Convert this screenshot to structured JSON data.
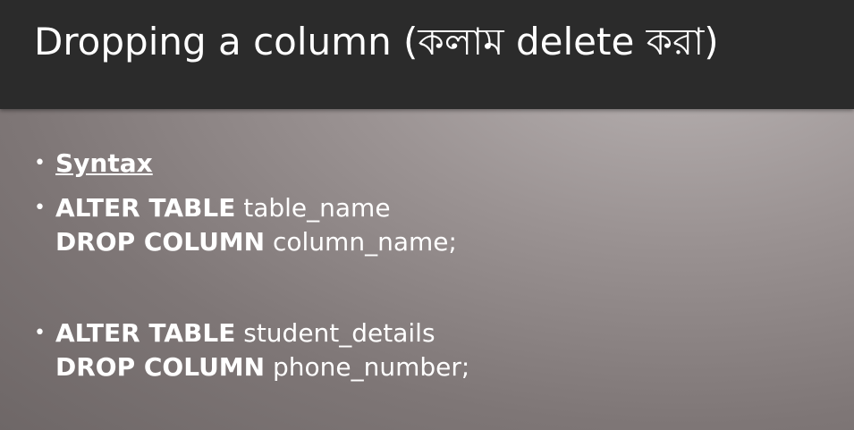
{
  "slide": {
    "title": "Dropping a column (কলাম  delete  করা)",
    "bullet_symbol": "•",
    "bullets": [
      {
        "label": "Syntax"
      },
      {
        "lines": [
          {
            "keyword": "ALTER TABLE",
            "text": " table_name"
          },
          {
            "keyword": "DROP COLUMN",
            "text": " column_name;"
          }
        ]
      },
      {
        "lines": [
          {
            "keyword": "ALTER TABLE",
            "text": " student_details"
          },
          {
            "keyword": "DROP COLUMN",
            "text": " phone_number;"
          }
        ]
      }
    ]
  }
}
